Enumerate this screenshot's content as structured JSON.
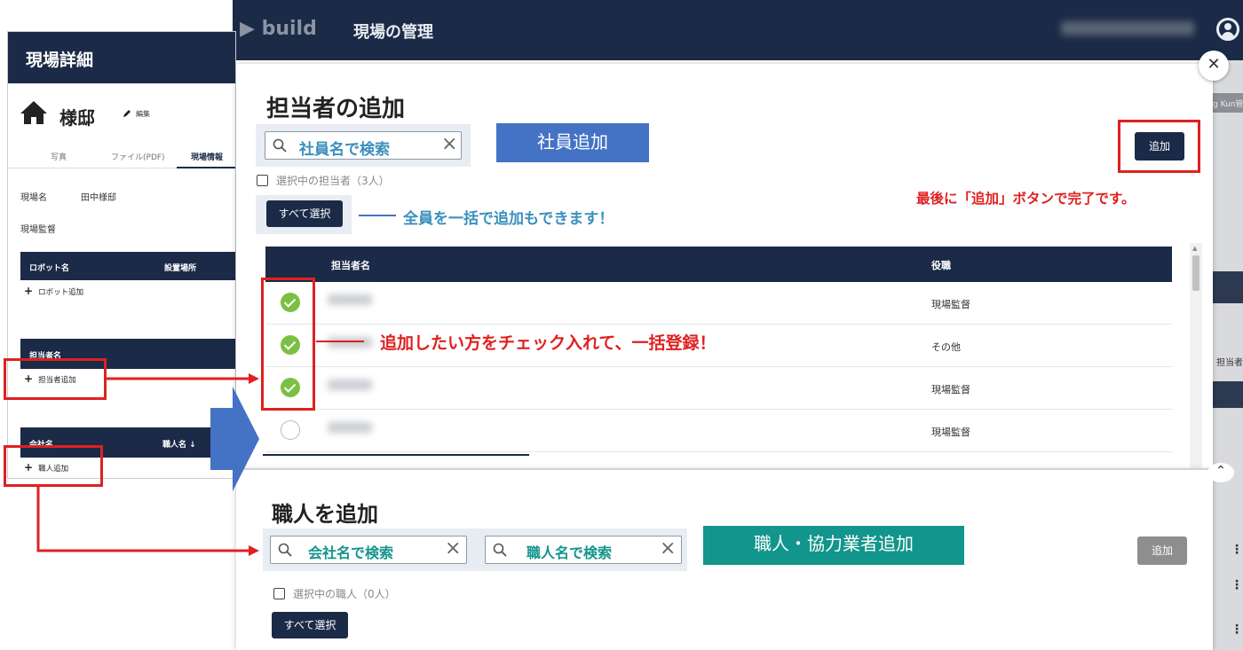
{
  "app": {
    "logo": "build",
    "title": "現場の管理",
    "user_name": "カバ工務店(株)",
    "right_strip_text": "g Kun管",
    "right_strip_text2": "担当者追"
  },
  "left_panel": {
    "title": "現場詳細",
    "site_name": "様邸",
    "edit_label": "編集",
    "tabs": [
      "写真",
      "ファイル(PDF)",
      "現場情報"
    ],
    "site_field_label": "現場名",
    "site_field_value": "田中様邸",
    "supervisor_label": "現場監督",
    "robot_table": {
      "col1": "ロボット名",
      "col2": "設置場所",
      "add_label": "ロボット追加"
    },
    "staff_table": {
      "col1": "担当者名",
      "add_label": "担当者追加"
    },
    "worker_table": {
      "col1": "会社名",
      "col2": "職人名 ↓",
      "add_label": "職人追加"
    }
  },
  "modal_staff": {
    "title": "担当者の追加",
    "search_placeholder": "社員名で検索",
    "selected_text": "選択中の担当者（3人）",
    "select_all": "すべて選択",
    "add_button": "追加",
    "columns": {
      "name": "担当者名",
      "role": "役職"
    },
    "rows": [
      {
        "checked": true,
        "role": "現場監督"
      },
      {
        "checked": true,
        "role": "その他"
      },
      {
        "checked": true,
        "role": "現場監督"
      },
      {
        "checked": false,
        "role": "現場監督"
      }
    ]
  },
  "modal_worker": {
    "title": "職人を追加",
    "search_company_placeholder": "会社名で検索",
    "search_worker_placeholder": "職人名で検索",
    "selected_text": "選択中の職人（0人）",
    "select_all": "すべて選択",
    "add_button": "追加"
  },
  "annotations": {
    "staff_add_label": "社員追加",
    "worker_add_label": "職人・協力業者追加",
    "finish_note": "最後に「追加」ボタンで完了です。",
    "select_all_note": "全員を一括で追加もできます！",
    "check_note": "追加したい方をチェック入れて、一括登録！"
  },
  "colors": {
    "navy": "#1b2a47",
    "annotation_red": "#e02020",
    "annotation_blue": "#4472c4",
    "annotation_teal": "#12958c",
    "check_green": "#7bc043"
  }
}
